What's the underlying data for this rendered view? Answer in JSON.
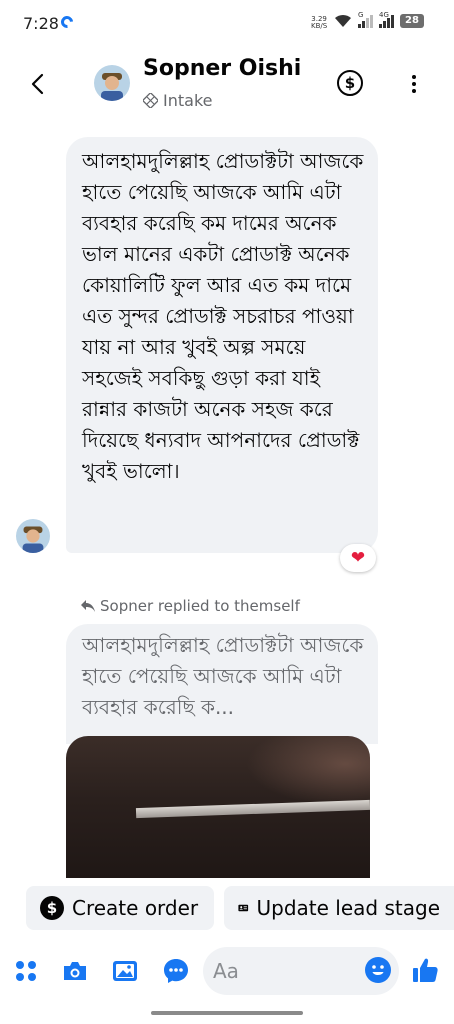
{
  "status_bar": {
    "time": "7:28",
    "speed_value": "3.29",
    "speed_unit": "KB/S",
    "network_label_1": "G",
    "network_label_2": "4G",
    "battery": "28"
  },
  "header": {
    "name": "Sopner Oishi",
    "subtitle": "Intake",
    "icons": [
      "back-arrow-icon",
      "dollar-icon",
      "more-vertical-icon"
    ]
  },
  "messages": [
    {
      "text": "আলহামদুলিল্লাহ প্রোডাক্টটা আজকে হাতে পেয়েছি আজকে আমি এটা ব্যবহার করেছি কম দামের অনেক ভাল মানের একটা প্রোডাক্ট অনেক কোয়ালিটি ফুল আর এত কম দামে এত সুন্দর প্রোডাক্ট সচরাচর পাওয়া যায় না আর খুবই অল্প সময়ে সহজেই সবকিছু গুড়া করা যাই  রান্নার কাজটা অনেক সহজ করে দিয়েছে ধন্যবাদ আপনাদের প্রোডাক্ট খুবই ভালো।",
      "reaction": "❤"
    }
  ],
  "reply": {
    "meta": "Sopner replied to themself",
    "quoted_text": "আলহামদুলিল্লাহ প্রোডাক্টটা আজকে হাতে পেয়েছি আজকে আমি এটা ব্যবহার করেছি ক..."
  },
  "actions": {
    "create_order": "Create order",
    "update_lead_stage": "Update lead stage"
  },
  "composer": {
    "placeholder": "Aa",
    "icons": [
      "grid-menu-icon",
      "camera-icon",
      "gallery-icon",
      "messenger-icon",
      "emoji-icon",
      "thumbs-up-icon"
    ]
  },
  "colors": {
    "accent": "#1877f2",
    "bubble": "#f0f2f5",
    "text": "#050505",
    "secondary": "#65676b"
  }
}
